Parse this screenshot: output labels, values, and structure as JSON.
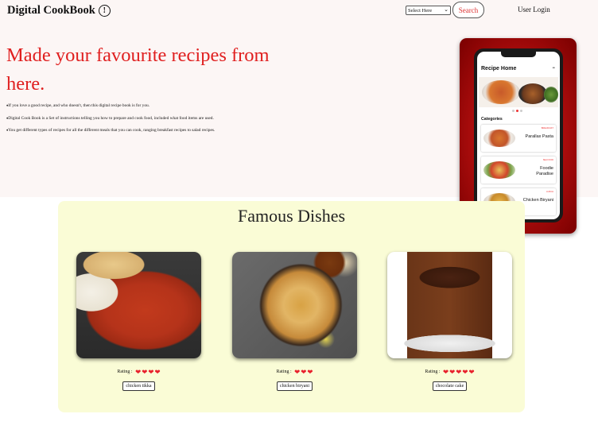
{
  "navbar": {
    "brand": "Digital CookBook",
    "brand_icon": "info-icon",
    "select_value": "Select Here",
    "search_label": "Search",
    "login_label": "User Login"
  },
  "hero": {
    "title": "Made your favourite recipes from here.",
    "bullets": [
      "If you love a good recipe, and who doesn't, then this digital recipe book is for you.",
      "Digital Cook Book is a Set of instructions telling you how to prepare and cook food, included what food items are used.",
      "You get different types of recipes for all the different meals that you can cook, ranging breakfast recipes to salad recipes."
    ]
  },
  "phone": {
    "title": "Recipe Home",
    "categories_label": "Categories",
    "items": [
      {
        "tag": "BREAKFAST",
        "name": "Parallax Pasta"
      },
      {
        "tag": "SEA FOOD",
        "name": "Foodie Paradise"
      },
      {
        "tag": "LUNCH",
        "name": "Chicken Biryani"
      }
    ]
  },
  "famous": {
    "title": "Famous Dishes",
    "rating_label": "Rating :",
    "dishes": [
      {
        "name": "chicken tikka",
        "rating": 4
      },
      {
        "name": "chicken biryani",
        "rating": 3
      },
      {
        "name": "chocolate cake",
        "rating": 5
      }
    ]
  },
  "colors": {
    "accent_red": "#e02020",
    "heart": "#e8212c",
    "famous_bg": "#fafcd6",
    "hero_bg": "#fcf6f5"
  }
}
